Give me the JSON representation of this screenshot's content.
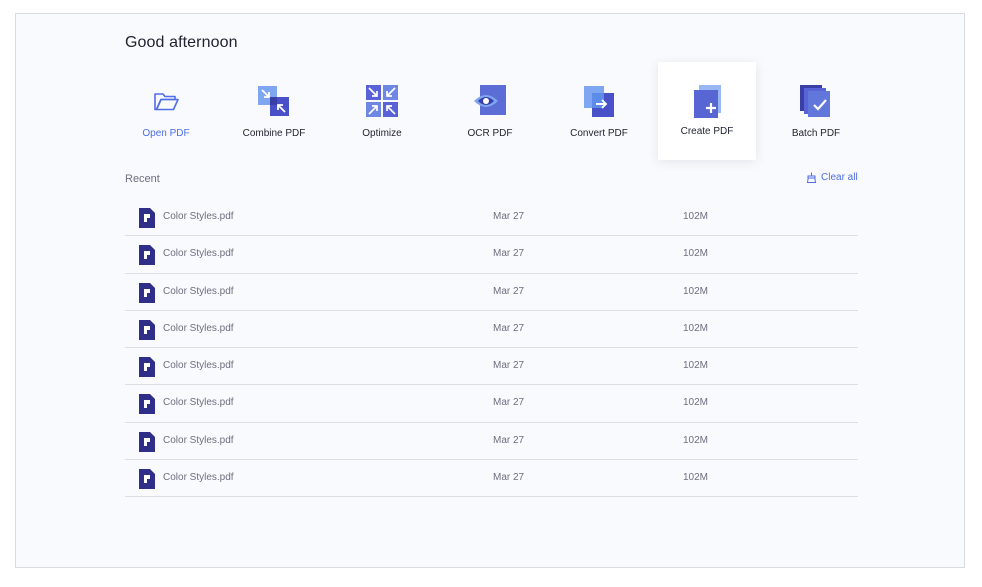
{
  "greeting": "Good afternoon",
  "tools": [
    {
      "label": "Open PDF",
      "icon": "folder-open-icon",
      "primary": true
    },
    {
      "label": "Combine PDF",
      "icon": "combine-icon"
    },
    {
      "label": "Optimize",
      "icon": "optimize-icon"
    },
    {
      "label": "OCR PDF",
      "icon": "ocr-eye-icon"
    },
    {
      "label": "Convert PDF",
      "icon": "convert-icon"
    },
    {
      "label": "Create PDF",
      "icon": "create-plus-icon",
      "active": true
    },
    {
      "label": "Batch PDF",
      "icon": "batch-check-icon"
    }
  ],
  "recent": {
    "title": "Recent",
    "clear_label": "Clear all",
    "clear_icon": "broom-icon",
    "file_icon": "pdf-file-icon",
    "files": [
      {
        "name": "Color Styles.pdf",
        "date": "Mar 27",
        "size": "102M"
      },
      {
        "name": "Color Styles.pdf",
        "date": "Mar 27",
        "size": "102M"
      },
      {
        "name": "Color Styles.pdf",
        "date": "Mar 27",
        "size": "102M"
      },
      {
        "name": "Color Styles.pdf",
        "date": "Mar 27",
        "size": "102M"
      },
      {
        "name": "Color Styles.pdf",
        "date": "Mar 27",
        "size": "102M"
      },
      {
        "name": "Color Styles.pdf",
        "date": "Mar 27",
        "size": "102M"
      },
      {
        "name": "Color Styles.pdf",
        "date": "Mar 27",
        "size": "102M"
      },
      {
        "name": "Color Styles.pdf",
        "date": "Mar 27",
        "size": "102M"
      }
    ]
  },
  "colors": {
    "accent": "#4f6ee8",
    "icon_dark": "#2f2f8a",
    "icon_mid": "#4a50c8",
    "icon_light": "#7fa6f0",
    "background": "#f9fafd"
  }
}
